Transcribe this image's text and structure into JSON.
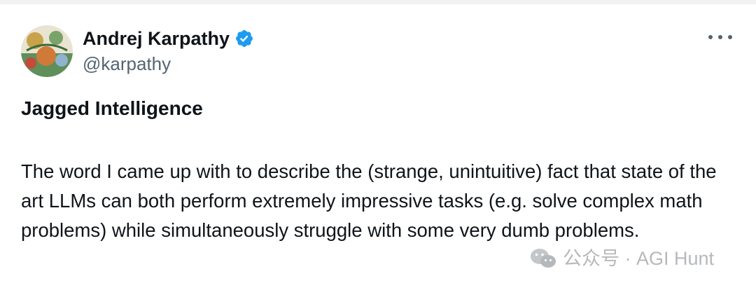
{
  "author": {
    "display_name": "Andrej Karpathy",
    "handle": "@karpathy",
    "verified": true,
    "avatar_icon": "avatar-illustration"
  },
  "tweet": {
    "title": "Jagged Intelligence",
    "body": "The word I came up with to describe the (strange, unintuitive) fact that state of the art LLMs can both perform extremely impressive tasks (e.g. solve complex math problems) while simultaneously struggle with some very dumb problems."
  },
  "menu": {
    "icon": "more-horizontal-icon"
  },
  "watermark": {
    "text": "公众号 · AGI Hunt",
    "icon": "wechat-icon"
  },
  "colors": {
    "text_primary": "#0f1419",
    "text_secondary": "#536471",
    "verified_blue": "#1d9bf0",
    "watermark_gray": "#b6b9bc"
  }
}
